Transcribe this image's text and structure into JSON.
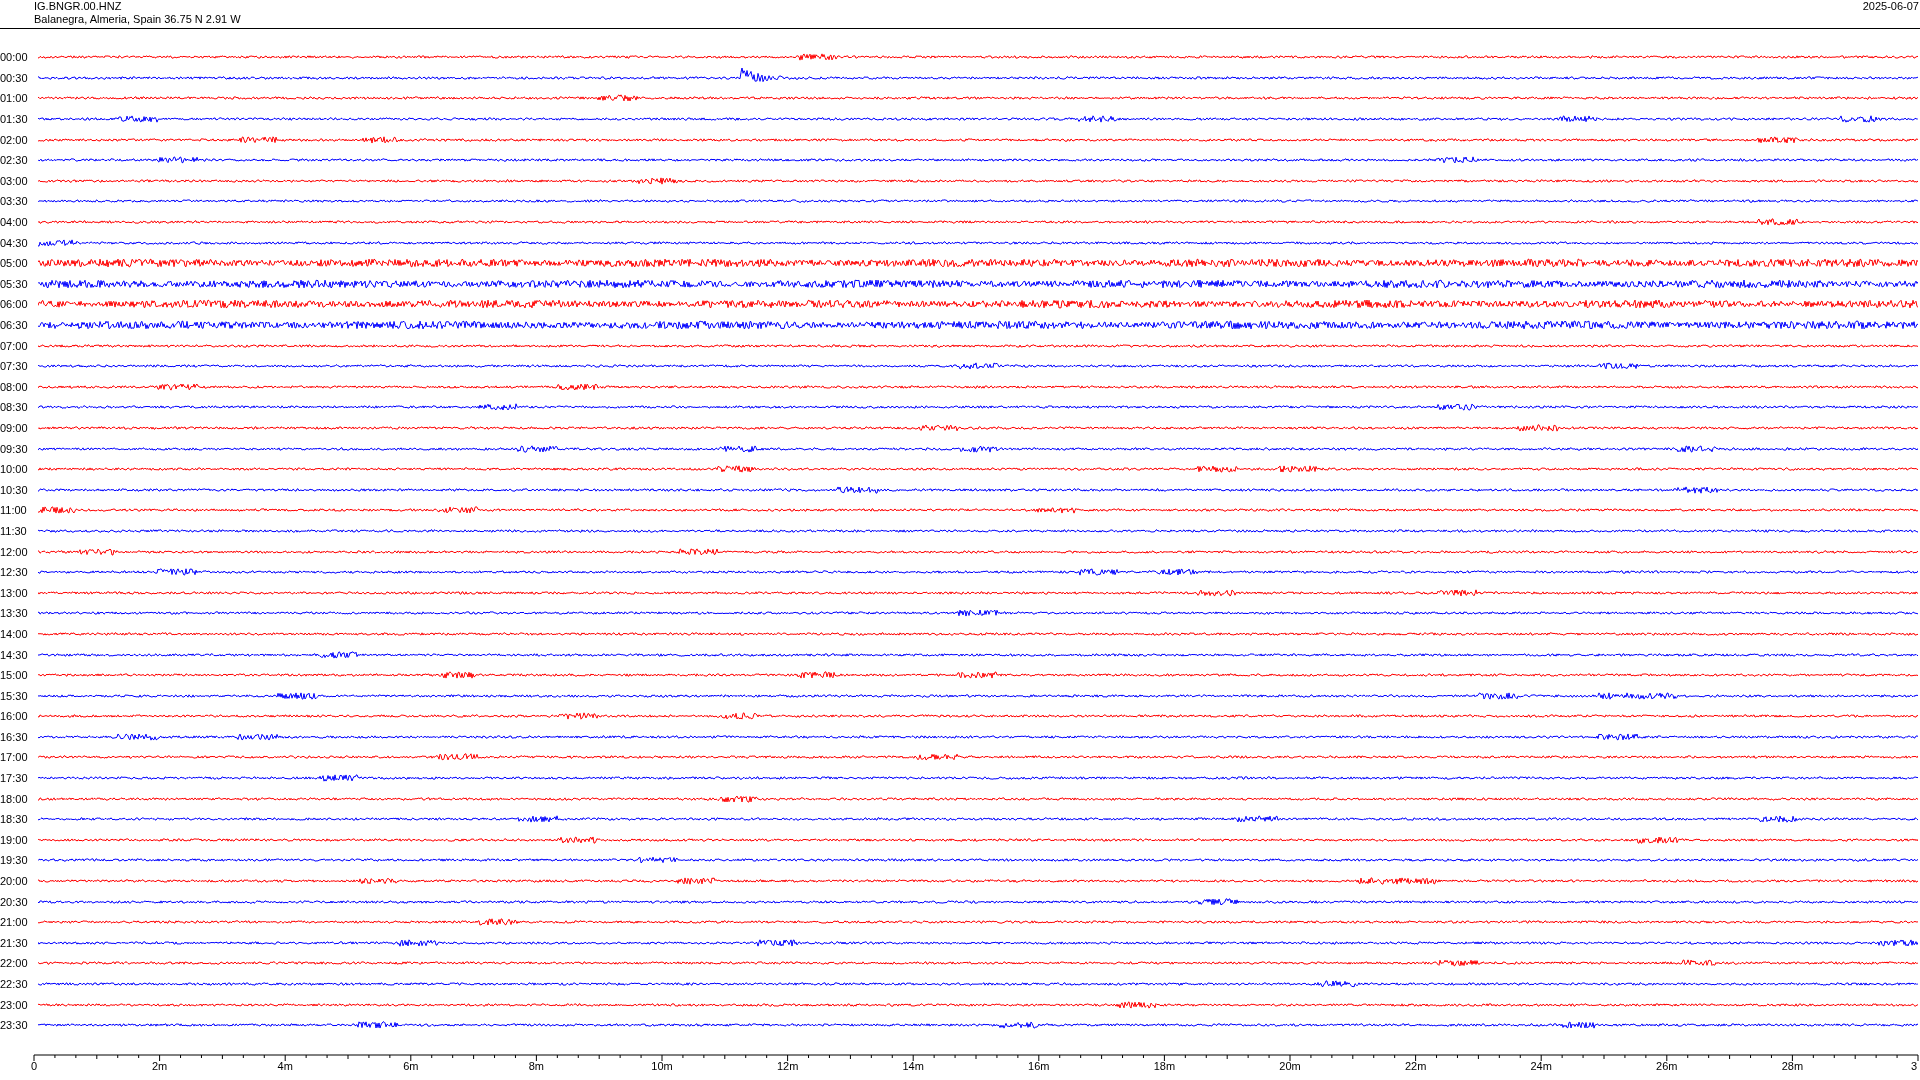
{
  "header": {
    "station": "IG.BNGR.00.HNZ",
    "location": "Balanegra, Almeria, Spain  36.75 N 2.91 W",
    "date": "2025-06-07"
  },
  "traces": [
    {
      "time": "00:00",
      "color": "#ff0000",
      "kind": "quiet"
    },
    {
      "time": "00:30",
      "color": "#0000ff",
      "kind": "event"
    },
    {
      "time": "01:00",
      "color": "#ff0000",
      "kind": "quiet"
    },
    {
      "time": "01:30",
      "color": "#0000ff",
      "kind": "quiet"
    },
    {
      "time": "02:00",
      "color": "#ff0000",
      "kind": "quiet"
    },
    {
      "time": "02:30",
      "color": "#0000ff",
      "kind": "quiet"
    },
    {
      "time": "03:00",
      "color": "#ff0000",
      "kind": "quiet"
    },
    {
      "time": "03:30",
      "color": "#0000ff",
      "kind": "quiet"
    },
    {
      "time": "04:00",
      "color": "#ff0000",
      "kind": "quiet"
    },
    {
      "time": "04:30",
      "color": "#0000ff",
      "kind": "quiet"
    },
    {
      "time": "05:00",
      "color": "#ff0000",
      "kind": "noisy"
    },
    {
      "time": "05:30",
      "color": "#0000ff",
      "kind": "noisy"
    },
    {
      "time": "06:00",
      "color": "#ff0000",
      "kind": "noisy"
    },
    {
      "time": "06:30",
      "color": "#0000ff",
      "kind": "noisy"
    },
    {
      "time": "07:00",
      "color": "#ff0000",
      "kind": "quiet"
    },
    {
      "time": "07:30",
      "color": "#0000ff",
      "kind": "quiet"
    },
    {
      "time": "08:00",
      "color": "#ff0000",
      "kind": "quiet"
    },
    {
      "time": "08:30",
      "color": "#0000ff",
      "kind": "quiet"
    },
    {
      "time": "09:00",
      "color": "#ff0000",
      "kind": "quiet"
    },
    {
      "time": "09:30",
      "color": "#0000ff",
      "kind": "quiet"
    },
    {
      "time": "10:00",
      "color": "#ff0000",
      "kind": "quiet"
    },
    {
      "time": "10:30",
      "color": "#0000ff",
      "kind": "quiet"
    },
    {
      "time": "11:00",
      "color": "#ff0000",
      "kind": "quiet"
    },
    {
      "time": "11:30",
      "color": "#0000ff",
      "kind": "quiet"
    },
    {
      "time": "12:00",
      "color": "#ff0000",
      "kind": "quiet"
    },
    {
      "time": "12:30",
      "color": "#0000ff",
      "kind": "quiet"
    },
    {
      "time": "13:00",
      "color": "#ff0000",
      "kind": "quiet"
    },
    {
      "time": "13:30",
      "color": "#0000ff",
      "kind": "quiet"
    },
    {
      "time": "14:00",
      "color": "#ff0000",
      "kind": "quiet"
    },
    {
      "time": "14:30",
      "color": "#0000ff",
      "kind": "quiet"
    },
    {
      "time": "15:00",
      "color": "#ff0000",
      "kind": "quiet"
    },
    {
      "time": "15:30",
      "color": "#0000ff",
      "kind": "quiet"
    },
    {
      "time": "16:00",
      "color": "#ff0000",
      "kind": "quiet"
    },
    {
      "time": "16:30",
      "color": "#0000ff",
      "kind": "quiet"
    },
    {
      "time": "17:00",
      "color": "#ff0000",
      "kind": "quiet"
    },
    {
      "time": "17:30",
      "color": "#0000ff",
      "kind": "quiet"
    },
    {
      "time": "18:00",
      "color": "#ff0000",
      "kind": "quiet"
    },
    {
      "time": "18:30",
      "color": "#0000ff",
      "kind": "quiet"
    },
    {
      "time": "19:00",
      "color": "#ff0000",
      "kind": "quiet"
    },
    {
      "time": "19:30",
      "color": "#0000ff",
      "kind": "quiet"
    },
    {
      "time": "20:00",
      "color": "#ff0000",
      "kind": "quiet"
    },
    {
      "time": "20:30",
      "color": "#0000ff",
      "kind": "quiet"
    },
    {
      "time": "21:00",
      "color": "#ff0000",
      "kind": "quiet"
    },
    {
      "time": "21:30",
      "color": "#0000ff",
      "kind": "quiet"
    },
    {
      "time": "22:00",
      "color": "#ff0000",
      "kind": "quiet"
    },
    {
      "time": "22:30",
      "color": "#0000ff",
      "kind": "quiet"
    },
    {
      "time": "23:00",
      "color": "#ff0000",
      "kind": "quiet"
    },
    {
      "time": "23:30",
      "color": "#0000ff",
      "kind": "quiet"
    }
  ],
  "x_axis": {
    "ticks": [
      "0",
      "2m",
      "4m",
      "6m",
      "8m",
      "10m",
      "12m",
      "14m",
      "16m",
      "18m",
      "20m",
      "22m",
      "24m",
      "26m",
      "28m",
      "3"
    ]
  }
}
